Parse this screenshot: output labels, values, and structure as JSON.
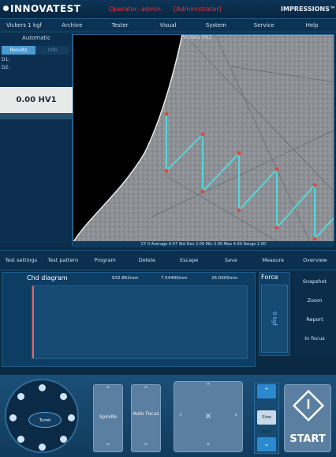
{
  "header": {
    "brand": "INNOVATEST",
    "operator": "Operator: admin",
    "role": "[Administrator]",
    "product": "IMPRESSIONS™"
  },
  "menu": [
    "Vickers 1 kgf",
    "Archive",
    "Tester",
    "Visual",
    "System",
    "Service",
    "Help"
  ],
  "left_panel": {
    "mode": "Automatic",
    "toggle": [
      "Results",
      "Info"
    ],
    "d1": "D1:",
    "d2": "D2:",
    "hardness": "0.00 HV1"
  },
  "image_view": {
    "title": "Vickers HV1",
    "status": "CY 0   Average 0.47   Std Dev 2.00   Min 2.00   Max 4.00   Range 2.00"
  },
  "toolbar": [
    "Test settings",
    "Test pattern",
    "Program",
    "Delete",
    "Escape",
    "Save",
    "Measure",
    "Overview"
  ],
  "diagram": {
    "title": "Chd diagram",
    "values": [
      "632.862mm",
      "7.54490mm",
      "26.0000mm"
    ],
    "force_label": "Force",
    "force_value": "0 kgf"
  },
  "right_buttons": [
    "Snapshot",
    "Zoom",
    "Report",
    "In focus"
  ],
  "controls": {
    "joystick_center": "Turret",
    "spindle": "Spindle",
    "auto_focus": "Auto Focus",
    "speed": "Slow light",
    "start": "START"
  },
  "colors": {
    "accent": "#2a89cf",
    "alert": "#e0333b",
    "background": "#0a2a44"
  }
}
